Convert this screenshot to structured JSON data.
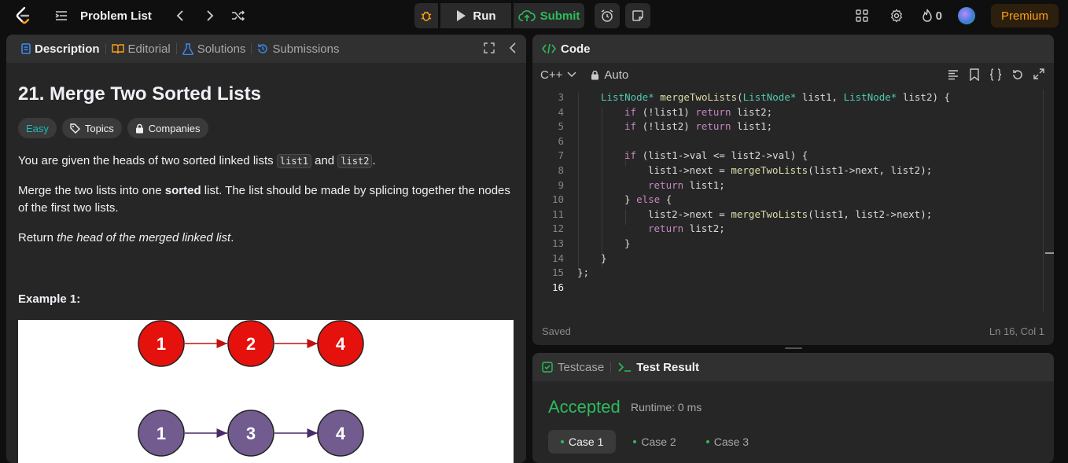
{
  "topbar": {
    "problem_list_label": "Problem List",
    "run_label": "Run",
    "submit_label": "Submit",
    "streak_count": "0",
    "premium_label": "Premium"
  },
  "description_panel": {
    "tabs": [
      {
        "label": "Description",
        "active": true
      },
      {
        "label": "Editorial",
        "active": false
      },
      {
        "label": "Solutions",
        "active": false
      },
      {
        "label": "Submissions",
        "active": false
      }
    ],
    "title": "21. Merge Two Sorted Lists",
    "difficulty": "Easy",
    "chips": [
      "Topics",
      "Companies"
    ],
    "para1": {
      "pre": "You are given the heads of two sorted linked lists ",
      "code1": "list1",
      "mid": " and ",
      "code2": "list2",
      "post": "."
    },
    "para2": {
      "pre": "Merge the two lists into one ",
      "bold": "sorted",
      "post": " list. The list should be made by splicing together the nodes of the first two lists."
    },
    "para3": {
      "pre": "Return ",
      "italic": "the head of the merged linked list",
      "post": "."
    },
    "example_label": "Example 1:",
    "diagram": {
      "list1": [
        "1",
        "2",
        "4"
      ],
      "list2": [
        "1",
        "3",
        "4"
      ],
      "list1_color": "#e5110d",
      "list2_color": "#715b8f"
    }
  },
  "code_panel": {
    "title": "Code",
    "language": "C++",
    "mode": "Auto",
    "lines": [
      {
        "n": "3",
        "cur": false
      },
      {
        "n": "4",
        "cur": false
      },
      {
        "n": "5",
        "cur": false
      },
      {
        "n": "6",
        "cur": false
      },
      {
        "n": "7",
        "cur": false
      },
      {
        "n": "8",
        "cur": false
      },
      {
        "n": "9",
        "cur": false
      },
      {
        "n": "10",
        "cur": false
      },
      {
        "n": "11",
        "cur": false
      },
      {
        "n": "12",
        "cur": false
      },
      {
        "n": "13",
        "cur": false
      },
      {
        "n": "14",
        "cur": false
      },
      {
        "n": "15",
        "cur": false
      },
      {
        "n": "16",
        "cur": true
      }
    ],
    "code": {
      "l3": {
        "t1": "ListNode*",
        "t2": " ",
        "f": "mergeTwoLists",
        "t3": "(",
        "t4": "ListNode*",
        "t5": " list1, ",
        "t6": "ListNode*",
        "t7": " list2) {"
      },
      "l4": {
        "k1": "if",
        "t1": " (!list1) ",
        "k2": "return",
        "t2": " list2;"
      },
      "l5": {
        "k1": "if",
        "t1": " (!list2) ",
        "k2": "return",
        "t2": " list1;"
      },
      "l7": {
        "k1": "if",
        "t1": " (list1->val <= list2->val) {"
      },
      "l8": {
        "t1": "list1->next = ",
        "f": "mergeTwoLists",
        "t2": "(list1->next, list2);"
      },
      "l9": {
        "k1": "return",
        "t1": " list1;"
      },
      "l10": {
        "t1": "} ",
        "k1": "else",
        "t2": " {"
      },
      "l11": {
        "t1": "list2->next = ",
        "f": "mergeTwoLists",
        "t2": "(list1, list2->next);"
      },
      "l12": {
        "k1": "return",
        "t1": " list2;"
      },
      "l13": {
        "t1": "}"
      },
      "l14": {
        "t1": "}"
      },
      "l15": {
        "t1": "};"
      }
    },
    "status_left": "Saved",
    "status_right": "Ln 16, Col 1"
  },
  "result_panel": {
    "tabs": [
      "Testcase",
      "Test Result"
    ],
    "verdict": "Accepted",
    "runtime": "Runtime: 0 ms",
    "cases": [
      "Case 1",
      "Case 2",
      "Case 3"
    ]
  },
  "colors": {
    "accent_green": "#2cbb5d",
    "premium_orange": "#ffa116",
    "easy_teal": "#1cbaba"
  }
}
